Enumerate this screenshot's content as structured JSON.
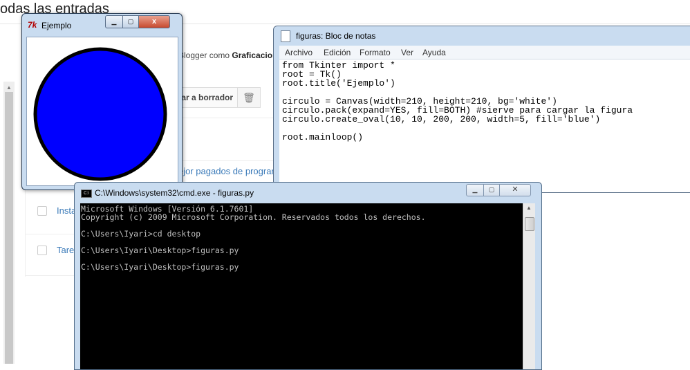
{
  "background": {
    "heading": "odas las entradas",
    "blogger_prefix": "Blogger como ",
    "blogger_name": "Graficacion",
    "borrador_label": "jar a borrador",
    "link_mejor": "ejor pagados de prograr",
    "row1_text": "Insta",
    "row2_text": "Tare"
  },
  "tk_window": {
    "title": "Ejemplo",
    "icon": "tk-feather-icon",
    "close_label": "x",
    "circle_fill": "#0000ff"
  },
  "notepad": {
    "title": "figuras: Bloc de notas",
    "menu": [
      "Archivo",
      "Edición",
      "Formato",
      "Ver",
      "Ayuda"
    ],
    "code": "from Tkinter import *\nroot = Tk()\nroot.title('Ejemplo')\n\ncirculo = Canvas(width=210, height=210, bg='white')\ncirculo.pack(expand=YES, fill=BOTH) #sierve para cargar la figura\ncirculo.create_oval(10, 10, 200, 200, width=5, fill='blue')\n\nroot.mainloop()"
  },
  "cmd": {
    "title": "C:\\Windows\\system32\\cmd.exe - figuras.py",
    "output": "Microsoft Windows [Versión 6.1.7601]\nCopyright (c) 2009 Microsoft Corporation. Reservados todos los derechos.\n\nC:\\Users\\Iyari>cd desktop\n\nC:\\Users\\Iyari\\Desktop>figuras.py\n\nC:\\Users\\Iyari\\Desktop>figuras.py"
  }
}
